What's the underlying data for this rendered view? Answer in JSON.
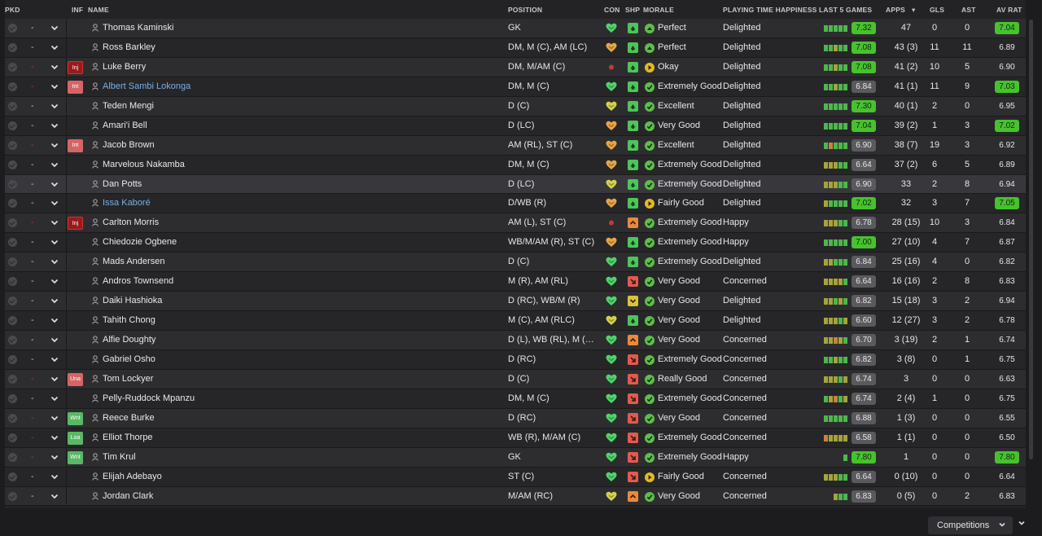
{
  "headers": {
    "pkd": "PKD",
    "inf": "INF",
    "name": "NAME",
    "position": "POSITION",
    "con": "CON",
    "shp": "SHP",
    "morale": "MORALE",
    "pth": "PLAYING TIME HAPPINESS",
    "last5": "LAST 5 GAMES",
    "apps": "APPS",
    "gls": "GLS",
    "ast": "AST",
    "avrat": "AV RAT"
  },
  "colors": {
    "rating_high": "#47c22e",
    "rating_low": "#5a5a5e",
    "con_green": "#4ed46a",
    "con_orange": "#e6a545",
    "con_yellow": "#d6d04a",
    "con_red": "#c83a2a",
    "shp_green": "#4ec45a",
    "shp_red": "#e25a4f",
    "shp_orange": "#e88a3c",
    "shp_yellow": "#d8c33a",
    "morale_green": "#5dbf47",
    "morale_yellow": "#e0bb27",
    "bar_green": "#4cb84c",
    "bar_yellow": "#a6a33a",
    "bar_orange": "#c8843a",
    "link": "#78aee8"
  },
  "players": [
    {
      "dash": "-",
      "inf": "",
      "name": "Thomas Kaminski",
      "link": false,
      "position": "GK",
      "con": "green",
      "shp": "green",
      "morale_icon": "up",
      "morale": "Perfect",
      "pth": "Delighted",
      "bars": [
        "g",
        "g",
        "g",
        "g",
        "g"
      ],
      "last5": "7.32",
      "last5_hi": true,
      "apps": "47",
      "gls": "0",
      "ast": "0",
      "avrat": "7.04",
      "av_hi": true
    },
    {
      "dash": "-",
      "inf": "",
      "name": "Ross Barkley",
      "link": false,
      "position": "DM, M (C), AM (LC)",
      "con": "orange",
      "shp": "green",
      "morale_icon": "up",
      "morale": "Perfect",
      "pth": "Delighted",
      "bars": [
        "g",
        "g",
        "y",
        "g",
        "g"
      ],
      "last5": "7.08",
      "last5_hi": true,
      "apps": "43 (3)",
      "gls": "11",
      "ast": "11",
      "avrat": "6.89",
      "av_hi": false
    },
    {
      "dash": "-",
      "inf": "Inj",
      "name": "Luke Berry",
      "link": false,
      "position": "DM, M/AM (C)",
      "con": "red",
      "shp": "green",
      "morale_icon": "right",
      "morale": "Okay",
      "pth": "Delighted",
      "bars": [
        "g",
        "g",
        "y",
        "g",
        "g"
      ],
      "last5": "7.08",
      "last5_hi": true,
      "apps": "41 (2)",
      "gls": "10",
      "ast": "5",
      "avrat": "6.90",
      "av_hi": false
    },
    {
      "dash": "-",
      "inf": "Int",
      "name": "Albert Sambi Lokonga",
      "link": true,
      "position": "DM, M (C)",
      "con": "green",
      "shp": "green",
      "morale_icon": "check",
      "morale": "Extremely Good",
      "pth": "Delighted",
      "bars": [
        "g",
        "g",
        "y",
        "g",
        "g"
      ],
      "last5": "6.84",
      "last5_hi": false,
      "apps": "41 (1)",
      "gls": "11",
      "ast": "9",
      "avrat": "7.03",
      "av_hi": true
    },
    {
      "dash": "-",
      "inf": "",
      "name": "Teden Mengi",
      "link": false,
      "position": "D (C)",
      "con": "yellow",
      "shp": "green",
      "morale_icon": "check",
      "morale": "Excellent",
      "pth": "Delighted",
      "bars": [
        "g",
        "g",
        "g",
        "g",
        "g"
      ],
      "last5": "7.30",
      "last5_hi": true,
      "apps": "40 (1)",
      "gls": "2",
      "ast": "0",
      "avrat": "6.95",
      "av_hi": false
    },
    {
      "dash": "-",
      "inf": "",
      "name": "Amari'i Bell",
      "link": false,
      "position": "D (LC)",
      "con": "orange",
      "shp": "green",
      "morale_icon": "check",
      "morale": "Very Good",
      "pth": "Delighted",
      "bars": [
        "g",
        "g",
        "g",
        "g",
        "g"
      ],
      "last5": "7.04",
      "last5_hi": true,
      "apps": "39 (2)",
      "gls": "1",
      "ast": "3",
      "avrat": "7.02",
      "av_hi": true
    },
    {
      "dash": "-",
      "inf": "Int",
      "name": "Jacob Brown",
      "link": false,
      "position": "AM (RL), ST (C)",
      "con": "orange",
      "shp": "green",
      "morale_icon": "check",
      "morale": "Excellent",
      "pth": "Delighted",
      "bars": [
        "g",
        "o",
        "g",
        "g",
        "g"
      ],
      "last5": "6.90",
      "last5_hi": false,
      "apps": "38 (7)",
      "gls": "19",
      "ast": "3",
      "avrat": "6.92",
      "av_hi": false
    },
    {
      "dash": "-",
      "inf": "",
      "name": "Marvelous Nakamba",
      "link": false,
      "position": "DM, M (C)",
      "con": "orange",
      "shp": "green",
      "morale_icon": "check",
      "morale": "Extremely Good",
      "pth": "Delighted",
      "bars": [
        "y",
        "y",
        "y",
        "g",
        "g"
      ],
      "last5": "6.64",
      "last5_hi": false,
      "apps": "37 (2)",
      "gls": "6",
      "ast": "5",
      "avrat": "6.89",
      "av_hi": false
    },
    {
      "dash": "-",
      "inf": "",
      "name": "Dan Potts",
      "link": false,
      "position": "D (LC)",
      "con": "yellow",
      "shp": "green",
      "morale_icon": "check",
      "morale": "Extremely Good",
      "pth": "Delighted",
      "bars": [
        "y",
        "y",
        "y",
        "g",
        "g"
      ],
      "last5": "6.90",
      "last5_hi": false,
      "apps": "33",
      "gls": "2",
      "ast": "8",
      "avrat": "6.94",
      "av_hi": false
    },
    {
      "dash": "-",
      "inf": "",
      "name": "Issa Kaboré",
      "link": true,
      "position": "D/WB (R)",
      "con": "orange",
      "shp": "green",
      "morale_icon": "right",
      "morale": "Fairly Good",
      "pth": "Delighted",
      "bars": [
        "y",
        "g",
        "g",
        "g",
        "g"
      ],
      "last5": "7.02",
      "last5_hi": true,
      "apps": "32",
      "gls": "3",
      "ast": "7",
      "avrat": "7.05",
      "av_hi": true
    },
    {
      "dash": "-",
      "inf": "Inj",
      "name": "Carlton Morris",
      "link": false,
      "position": "AM (L), ST (C)",
      "con": "red",
      "shp": "orange",
      "morale_icon": "check",
      "morale": "Extremely Good",
      "pth": "Happy",
      "bars": [
        "y",
        "y",
        "y",
        "g",
        "g"
      ],
      "last5": "6.78",
      "last5_hi": false,
      "apps": "28 (15)",
      "gls": "10",
      "ast": "3",
      "avrat": "6.84",
      "av_hi": false
    },
    {
      "dash": "-",
      "inf": "",
      "name": "Chiedozie Ogbene",
      "link": false,
      "position": "WB/M/AM (R), ST (C)",
      "con": "orange",
      "shp": "green",
      "morale_icon": "check",
      "morale": "Extremely Good",
      "pth": "Happy",
      "bars": [
        "g",
        "g",
        "g",
        "g",
        "g"
      ],
      "last5": "7.00",
      "last5_hi": true,
      "apps": "27 (10)",
      "gls": "4",
      "ast": "7",
      "avrat": "6.87",
      "av_hi": false
    },
    {
      "dash": "-",
      "inf": "",
      "name": "Mads Andersen",
      "link": false,
      "position": "D (C)",
      "con": "green",
      "shp": "green",
      "morale_icon": "check",
      "morale": "Extremely Good",
      "pth": "Delighted",
      "bars": [
        "y",
        "y",
        "g",
        "g",
        "g"
      ],
      "last5": "6.84",
      "last5_hi": false,
      "apps": "25 (16)",
      "gls": "4",
      "ast": "0",
      "avrat": "6.82",
      "av_hi": false
    },
    {
      "dash": "-",
      "inf": "",
      "name": "Andros Townsend",
      "link": false,
      "position": "M (R), AM (RL)",
      "con": "green",
      "shp": "red",
      "morale_icon": "check",
      "morale": "Very Good",
      "pth": "Concerned",
      "bars": [
        "y",
        "y",
        "y",
        "y",
        "g"
      ],
      "last5": "6.64",
      "last5_hi": false,
      "apps": "16 (16)",
      "gls": "2",
      "ast": "8",
      "avrat": "6.83",
      "av_hi": false
    },
    {
      "dash": "-",
      "inf": "",
      "name": "Daiki Hashioka",
      "link": false,
      "position": "D (RC), WB/M (R)",
      "con": "green",
      "shp": "yellow",
      "morale_icon": "check",
      "morale": "Very Good",
      "pth": "Delighted",
      "bars": [
        "y",
        "y",
        "g",
        "y",
        "g"
      ],
      "last5": "6.82",
      "last5_hi": false,
      "apps": "15 (18)",
      "gls": "3",
      "ast": "2",
      "avrat": "6.94",
      "av_hi": false
    },
    {
      "dash": "-",
      "inf": "",
      "name": "Tahith Chong",
      "link": false,
      "position": "M (C), AM (RLC)",
      "con": "yellow",
      "shp": "green",
      "morale_icon": "check",
      "morale": "Very Good",
      "pth": "Delighted",
      "bars": [
        "y",
        "y",
        "y",
        "g",
        "y"
      ],
      "last5": "6.60",
      "last5_hi": false,
      "apps": "12 (27)",
      "gls": "3",
      "ast": "2",
      "avrat": "6.78",
      "av_hi": false
    },
    {
      "dash": "-",
      "inf": "",
      "name": "Alfie Doughty",
      "link": false,
      "position": "D (L), WB (RL), M (L), AM (L)",
      "con": "green",
      "shp": "orange",
      "morale_icon": "check",
      "morale": "Very Good",
      "pth": "Concerned",
      "bars": [
        "y",
        "y",
        "o",
        "y",
        "g"
      ],
      "last5": "6.70",
      "last5_hi": false,
      "apps": "3 (19)",
      "gls": "2",
      "ast": "1",
      "avrat": "6.74",
      "av_hi": false
    },
    {
      "dash": "-",
      "inf": "",
      "name": "Gabriel Osho",
      "link": false,
      "position": "D (RC)",
      "con": "green",
      "shp": "red",
      "morale_icon": "check",
      "morale": "Extremely Good",
      "pth": "Concerned",
      "bars": [
        "g",
        "g",
        "y",
        "g",
        "g"
      ],
      "last5": "6.82",
      "last5_hi": false,
      "apps": "3 (8)",
      "gls": "0",
      "ast": "1",
      "avrat": "6.75",
      "av_hi": false
    },
    {
      "dash": "-",
      "inf": "Una",
      "name": "Tom Lockyer",
      "link": false,
      "position": "D (C)",
      "con": "green",
      "shp": "red",
      "morale_icon": "check",
      "morale": "Really Good",
      "pth": "Concerned",
      "bars": [
        "y",
        "y",
        "y",
        "g",
        "y"
      ],
      "last5": "6.74",
      "last5_hi": false,
      "apps": "3",
      "gls": "0",
      "ast": "0",
      "avrat": "6.63",
      "av_hi": false
    },
    {
      "dash": "-",
      "inf": "",
      "name": "Pelly-Ruddock Mpanzu",
      "link": false,
      "position": "DM, M (C)",
      "con": "green",
      "shp": "red",
      "morale_icon": "check",
      "morale": "Extremely Good",
      "pth": "Concerned",
      "bars": [
        "g",
        "y",
        "o",
        "g",
        "y"
      ],
      "last5": "6.74",
      "last5_hi": false,
      "apps": "2 (4)",
      "gls": "1",
      "ast": "0",
      "avrat": "6.75",
      "av_hi": false
    },
    {
      "dash": "-",
      "inf": "Wnt",
      "name": "Reece Burke",
      "link": false,
      "position": "D (RC)",
      "con": "green",
      "shp": "red",
      "morale_icon": "check",
      "morale": "Very Good",
      "pth": "Concerned",
      "bars": [
        "g",
        "g",
        "g",
        "g",
        "g"
      ],
      "last5": "6.88",
      "last5_hi": false,
      "apps": "1 (3)",
      "gls": "0",
      "ast": "0",
      "avrat": "6.55",
      "av_hi": false
    },
    {
      "dash": "-",
      "inf": "Loa",
      "name": "Elliot Thorpe",
      "link": false,
      "position": "WB (R), M/AM (C)",
      "con": "green",
      "shp": "red",
      "morale_icon": "check",
      "morale": "Extremely Good",
      "pth": "Concerned",
      "bars": [
        "o",
        "y",
        "y",
        "y",
        "y"
      ],
      "last5": "6.58",
      "last5_hi": false,
      "apps": "1 (1)",
      "gls": "0",
      "ast": "0",
      "avrat": "6.50",
      "av_hi": false
    },
    {
      "dash": "-",
      "inf": "Wnt",
      "name": "Tim Krul",
      "link": false,
      "position": "GK",
      "con": "green",
      "shp": "red",
      "morale_icon": "check",
      "morale": "Extremely Good",
      "pth": "Happy",
      "bars": [
        "g"
      ],
      "last5": "7.80",
      "last5_hi": true,
      "apps": "1",
      "gls": "0",
      "ast": "0",
      "avrat": "7.80",
      "av_hi": true
    },
    {
      "dash": "-",
      "inf": "",
      "name": "Elijah Adebayo",
      "link": false,
      "position": "ST (C)",
      "con": "green",
      "shp": "red",
      "morale_icon": "right",
      "morale": "Fairly Good",
      "pth": "Concerned",
      "bars": [
        "y",
        "y",
        "y",
        "g",
        "g"
      ],
      "last5": "6.64",
      "last5_hi": false,
      "apps": "0 (10)",
      "gls": "0",
      "ast": "0",
      "avrat": "6.64",
      "av_hi": false
    },
    {
      "dash": "-",
      "inf": "",
      "name": "Jordan Clark",
      "link": false,
      "position": "M/AM (RC)",
      "con": "yellow",
      "shp": "orange",
      "morale_icon": "check",
      "morale": "Very Good",
      "pth": "Concerned",
      "bars": [
        "y",
        "g",
        "g"
      ],
      "last5": "6.83",
      "last5_hi": false,
      "apps": "0 (5)",
      "gls": "0",
      "ast": "2",
      "avrat": "6.83",
      "av_hi": false
    }
  ],
  "footer": {
    "competitions": "Competitions"
  }
}
